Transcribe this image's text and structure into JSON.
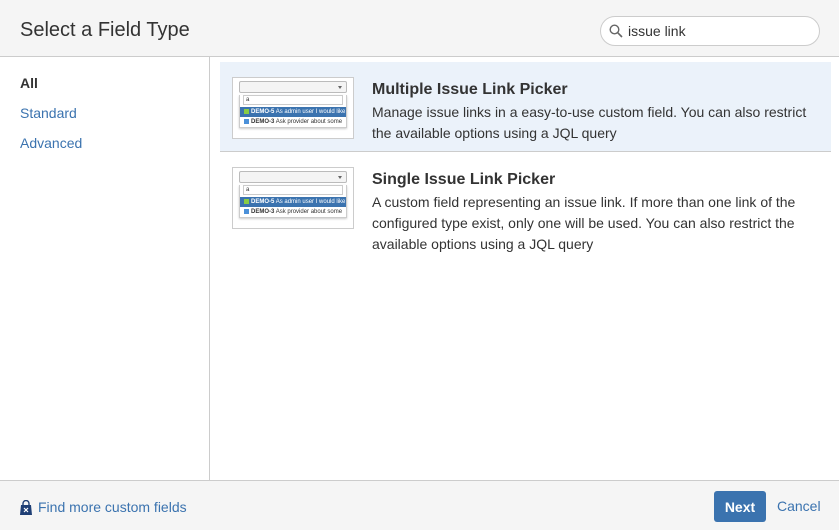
{
  "header": {
    "title": "Select a Field Type",
    "search": {
      "value": "issue link",
      "icon": "search-icon"
    }
  },
  "sidebar": {
    "items": [
      {
        "label": "All",
        "active": true
      },
      {
        "label": "Standard"
      },
      {
        "label": "Advanced"
      }
    ]
  },
  "fields": [
    {
      "name": "Multiple Issue Link Picker",
      "description": "Manage issue links in a easy-to-use custom field. You can also restrict the available options using a JQL query",
      "selected": true
    },
    {
      "name": "Single Issue Link Picker",
      "description": "A custom field representing an issue link. If more than one link of the configured type exist, only one will be used. You can also restrict the available options using a JQL query",
      "selected": false
    }
  ],
  "thumbnail": {
    "search_text": "a",
    "rows": [
      {
        "key": "DEMO-5",
        "summary": "As admin user I would like"
      },
      {
        "key": "DEMO-3",
        "summary": "Ask provider about some"
      }
    ]
  },
  "footer": {
    "more_link": "Find more custom fields",
    "next": "Next",
    "cancel": "Cancel"
  },
  "colors": {
    "accent": "#3b73af",
    "selected_bg": "#ebf2fa"
  }
}
